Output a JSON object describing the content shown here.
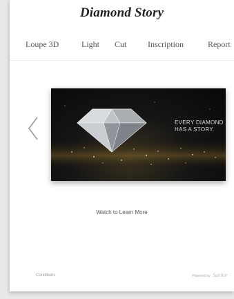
{
  "header": {
    "title": "Diamond Story"
  },
  "nav": {
    "tabs": [
      {
        "label": "Loupe 3D"
      },
      {
        "label": "Light"
      },
      {
        "label": "Cut"
      },
      {
        "label": "Inscription"
      },
      {
        "label": "Report"
      }
    ]
  },
  "carousel": {
    "video": {
      "caption_line1": "EVERY DIAMOND",
      "caption_line2": "HAS A STORY."
    },
    "link_text": "Watch to Learn More"
  },
  "footer": {
    "left_text": "Conditions",
    "right_text": "Powered by",
    "brand": "Sarine"
  },
  "icons": {
    "prev": "chevron-left-icon",
    "diamond": "diamond-icon"
  },
  "colors": {
    "background": "#ffffff",
    "text": "#222222",
    "video_background": "#0b0b0b"
  }
}
